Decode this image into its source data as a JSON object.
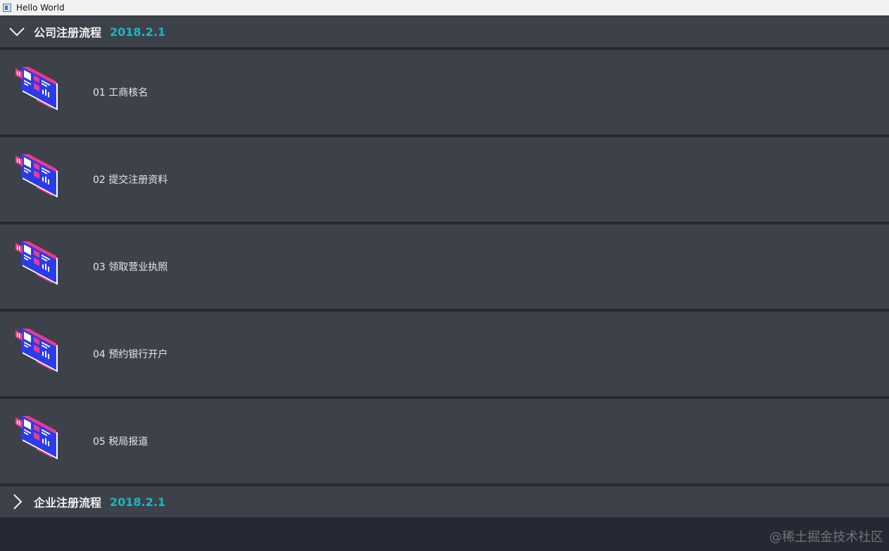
{
  "window": {
    "title": "Hello World"
  },
  "groups": [
    {
      "title": "公司注册流程",
      "date": "2018.2.1",
      "expanded": true
    },
    {
      "title": "企业注册流程",
      "date": "2018.2.1",
      "expanded": false
    }
  ],
  "items": [
    {
      "label": "01 工商核名",
      "icon": "dashboard-illustration-icon"
    },
    {
      "label": "02 提交注册资料",
      "icon": "dashboard-illustration-icon"
    },
    {
      "label": "03 领取营业执照",
      "icon": "dashboard-illustration-icon"
    },
    {
      "label": "04 预约银行开户",
      "icon": "dashboard-illustration-icon"
    },
    {
      "label": "05 税局报道",
      "icon": "dashboard-illustration-icon"
    }
  ],
  "watermark": "@稀土掘金技术社区",
  "colors": {
    "panel": "#3d424a",
    "background": "#252933",
    "accent_date": "#1fb6c1",
    "illustration_blue": "#2b3be8",
    "illustration_pink": "#f0388c"
  }
}
